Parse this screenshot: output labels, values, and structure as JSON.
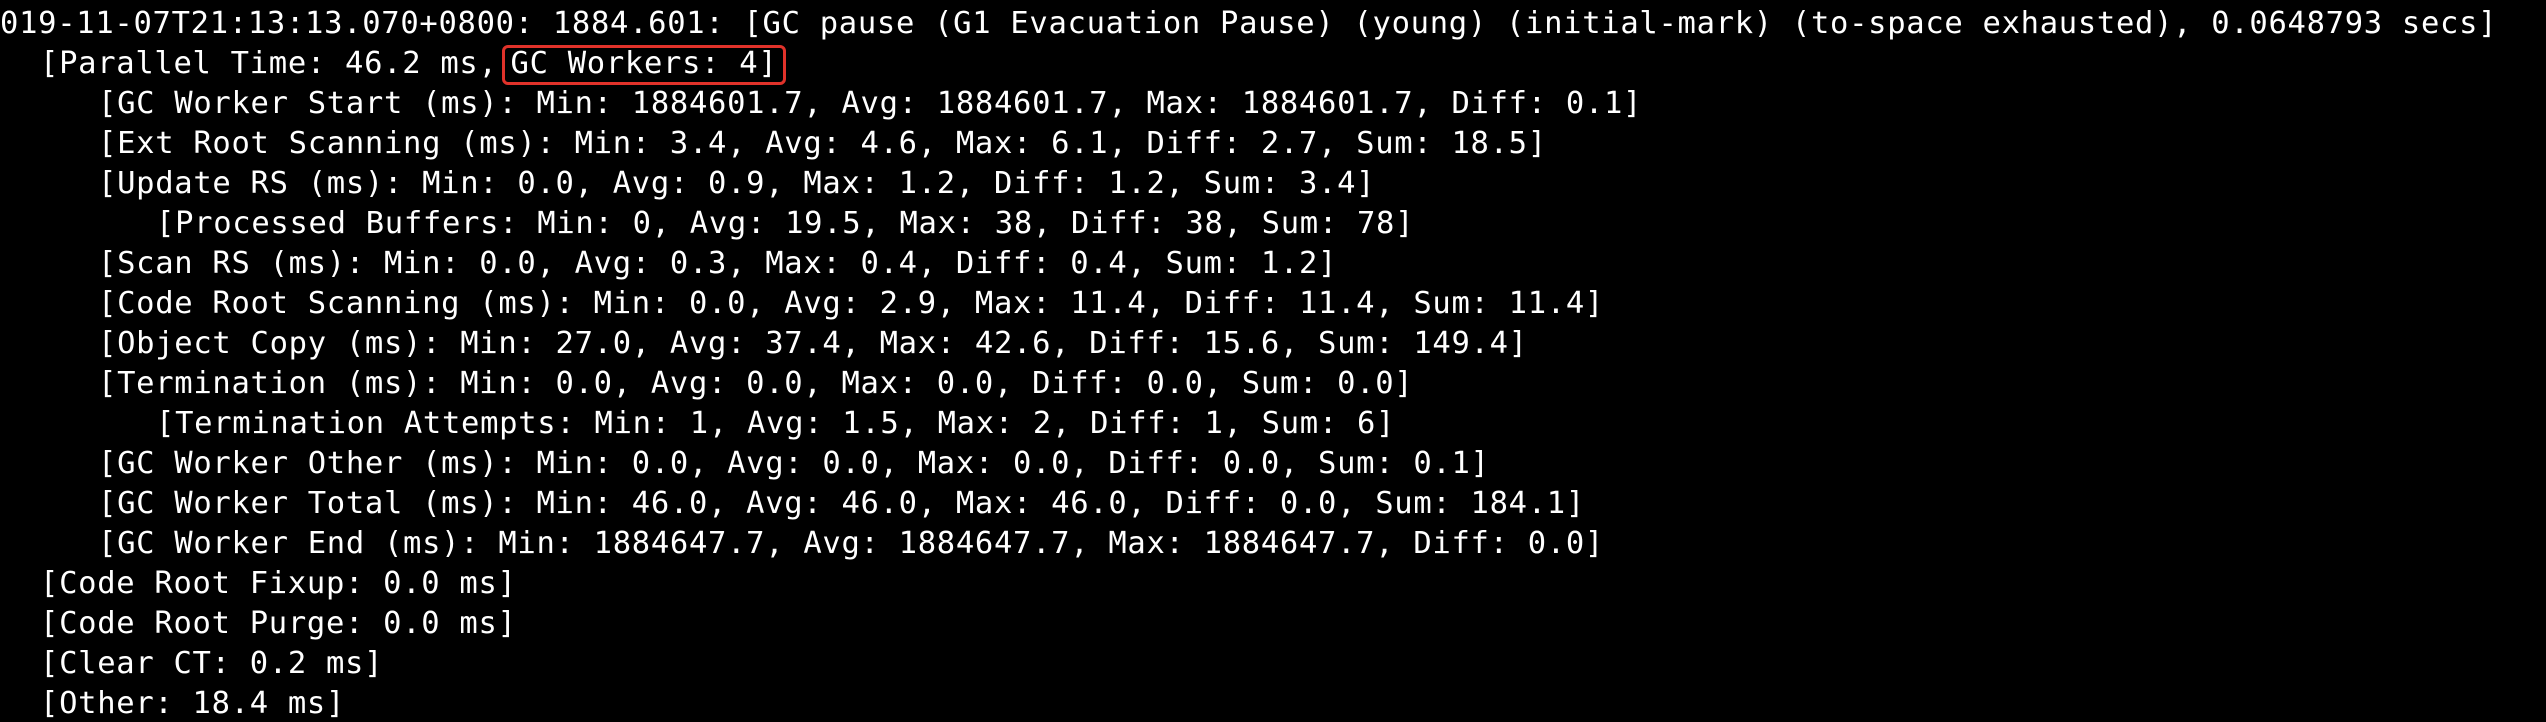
{
  "terminal": {
    "lines": {
      "l0": "019-11-07T21:13:13.070+0800: 1884.601: [GC pause (G1 Evacuation Pause) (young) (initial-mark) (to-space exhausted), 0.0648793 secs]",
      "l1_prefix": "[Parallel Time: 46.2 ms,",
      "l1_highlight": "GC Workers: 4]",
      "l2": "[GC Worker Start (ms): Min: 1884601.7, Avg: 1884601.7, Max: 1884601.7, Diff: 0.1]",
      "l3": "[Ext Root Scanning (ms): Min: 3.4, Avg: 4.6, Max: 6.1, Diff: 2.7, Sum: 18.5]",
      "l4": "[Update RS (ms): Min: 0.0, Avg: 0.9, Max: 1.2, Diff: 1.2, Sum: 3.4]",
      "l5": "[Processed Buffers: Min: 0, Avg: 19.5, Max: 38, Diff: 38, Sum: 78]",
      "l6": "[Scan RS (ms): Min: 0.0, Avg: 0.3, Max: 0.4, Diff: 0.4, Sum: 1.2]",
      "l7": "[Code Root Scanning (ms): Min: 0.0, Avg: 2.9, Max: 11.4, Diff: 11.4, Sum: 11.4]",
      "l8": "[Object Copy (ms): Min: 27.0, Avg: 37.4, Max: 42.6, Diff: 15.6, Sum: 149.4]",
      "l9": "[Termination (ms): Min: 0.0, Avg: 0.0, Max: 0.0, Diff: 0.0, Sum: 0.0]",
      "l10": "[Termination Attempts: Min: 1, Avg: 1.5, Max: 2, Diff: 1, Sum: 6]",
      "l11": "[GC Worker Other (ms): Min: 0.0, Avg: 0.0, Max: 0.0, Diff: 0.0, Sum: 0.1]",
      "l12": "[GC Worker Total (ms): Min: 46.0, Avg: 46.0, Max: 46.0, Diff: 0.0, Sum: 184.1]",
      "l13": "[GC Worker End (ms): Min: 1884647.7, Avg: 1884647.7, Max: 1884647.7, Diff: 0.0]",
      "l14": "[Code Root Fixup: 0.0 ms]",
      "l15": "[Code Root Purge: 0.0 ms]",
      "l16": "[Clear CT: 0.2 ms]",
      "l17": "[Other: 18.4 ms]"
    },
    "colors": {
      "background": "#000000",
      "text": "#ffffff",
      "highlight_border": "#e0322a"
    }
  }
}
